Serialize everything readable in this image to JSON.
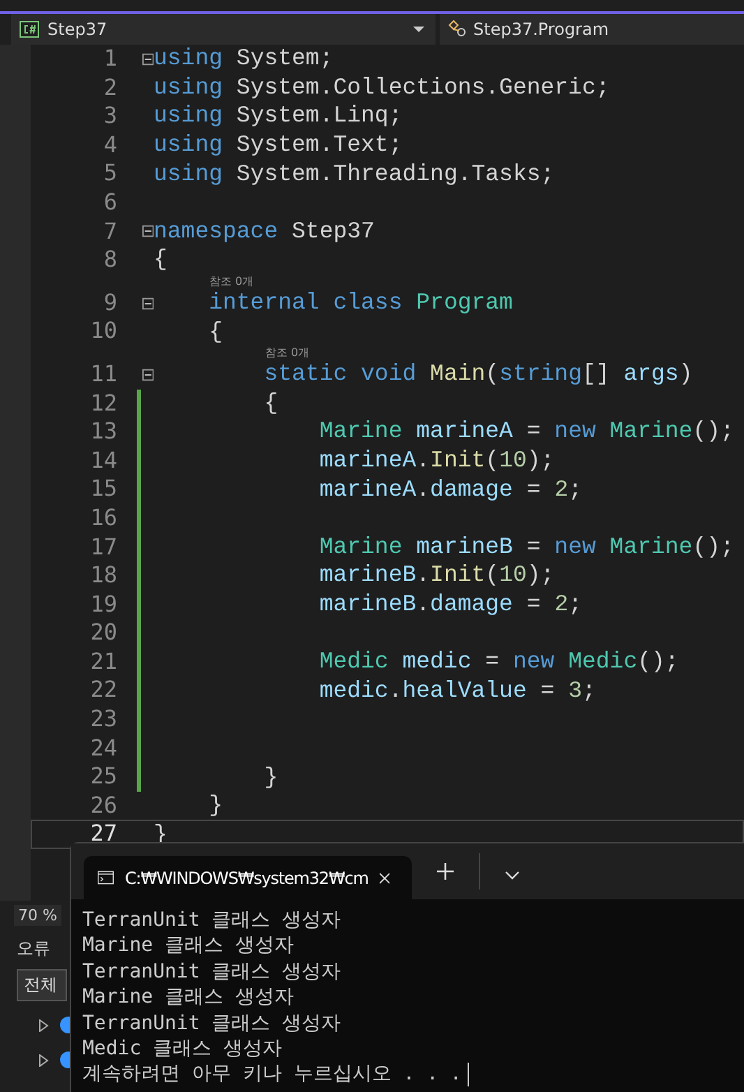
{
  "nav_bar": {
    "project": "Step37",
    "member": "Step37.Program"
  },
  "editor": {
    "lines": [
      {
        "number": "1",
        "changed": false,
        "current": false,
        "fold": true,
        "tokens": [
          {
            "text": "using",
            "kind": "keyword"
          },
          {
            "text": " System;",
            "kind": "plain"
          }
        ]
      },
      {
        "number": "2",
        "changed": false,
        "current": false,
        "fold": false,
        "tokens": [
          {
            "text": "using",
            "kind": "keyword"
          },
          {
            "text": " System.Collections.Generic;",
            "kind": "plain"
          }
        ]
      },
      {
        "number": "3",
        "changed": false,
        "current": false,
        "fold": false,
        "tokens": [
          {
            "text": "using",
            "kind": "keyword"
          },
          {
            "text": " System.Linq;",
            "kind": "plain"
          }
        ]
      },
      {
        "number": "4",
        "changed": false,
        "current": false,
        "fold": false,
        "tokens": [
          {
            "text": "using",
            "kind": "keyword"
          },
          {
            "text": " System.Text;",
            "kind": "plain"
          }
        ]
      },
      {
        "number": "5",
        "changed": false,
        "current": false,
        "fold": false,
        "tokens": [
          {
            "text": "using",
            "kind": "keyword"
          },
          {
            "text": " System.Threading.Tasks;",
            "kind": "plain"
          }
        ]
      },
      {
        "number": "6",
        "changed": false,
        "current": false,
        "fold": false
      },
      {
        "number": "7",
        "changed": false,
        "current": false,
        "fold": true,
        "tokens": [
          {
            "text": "namespace",
            "kind": "keyword"
          },
          {
            "text": " Step37",
            "kind": "plain"
          }
        ]
      },
      {
        "number": "8",
        "changed": false,
        "current": false,
        "fold": false,
        "tokens": [
          {
            "text": "{",
            "kind": "plain"
          }
        ]
      },
      {
        "number": "9",
        "changed": false,
        "current": false,
        "fold": true,
        "codelens": "참조 0개",
        "tokens": [
          {
            "text": "    internal class",
            "kind": "keyword"
          },
          {
            "text": " Program",
            "kind": "type"
          }
        ]
      },
      {
        "number": "10",
        "changed": false,
        "current": false,
        "fold": false,
        "tokens": [
          {
            "text": "    {",
            "kind": "plain"
          }
        ]
      },
      {
        "number": "11",
        "changed": false,
        "current": false,
        "fold": true,
        "codelens": "참조 0개",
        "tokens": [
          {
            "text": "        static void",
            "kind": "keyword"
          },
          {
            "text": " Main",
            "kind": "method"
          },
          {
            "text": "(",
            "kind": "plain"
          },
          {
            "text": "string",
            "kind": "keyword"
          },
          {
            "text": "[] ",
            "kind": "plain"
          },
          {
            "text": "args",
            "kind": "variable"
          },
          {
            "text": ")",
            "kind": "plain"
          }
        ]
      },
      {
        "number": "12",
        "changed": true,
        "current": false,
        "fold": false,
        "tokens": [
          {
            "text": "        {",
            "kind": "plain"
          }
        ]
      },
      {
        "number": "13",
        "changed": true,
        "current": false,
        "fold": false,
        "tokens": [
          {
            "text": "            Marine",
            "kind": "type"
          },
          {
            "text": " marineA",
            "kind": "variable"
          },
          {
            "text": " = ",
            "kind": "plain"
          },
          {
            "text": "new",
            "kind": "keyword"
          },
          {
            "text": " Marine",
            "kind": "type"
          },
          {
            "text": "();",
            "kind": "plain"
          }
        ]
      },
      {
        "number": "14",
        "changed": true,
        "current": false,
        "fold": false,
        "tokens": [
          {
            "text": "            marineA",
            "kind": "variable"
          },
          {
            "text": ".",
            "kind": "plain"
          },
          {
            "text": "Init",
            "kind": "method"
          },
          {
            "text": "(",
            "kind": "plain"
          },
          {
            "text": "10",
            "kind": "number"
          },
          {
            "text": ");",
            "kind": "plain"
          }
        ]
      },
      {
        "number": "15",
        "changed": true,
        "current": false,
        "fold": false,
        "tokens": [
          {
            "text": "            marineA",
            "kind": "variable"
          },
          {
            "text": ".",
            "kind": "plain"
          },
          {
            "text": "damage",
            "kind": "variable"
          },
          {
            "text": " = ",
            "kind": "plain"
          },
          {
            "text": "2",
            "kind": "number"
          },
          {
            "text": ";",
            "kind": "plain"
          }
        ]
      },
      {
        "number": "16",
        "changed": true,
        "current": false,
        "fold": false
      },
      {
        "number": "17",
        "changed": true,
        "current": false,
        "fold": false,
        "tokens": [
          {
            "text": "            Marine",
            "kind": "type"
          },
          {
            "text": " marineB",
            "kind": "variable"
          },
          {
            "text": " = ",
            "kind": "plain"
          },
          {
            "text": "new",
            "kind": "keyword"
          },
          {
            "text": " Marine",
            "kind": "type"
          },
          {
            "text": "();",
            "kind": "plain"
          }
        ]
      },
      {
        "number": "18",
        "changed": true,
        "current": false,
        "fold": false,
        "tokens": [
          {
            "text": "            marineB",
            "kind": "variable"
          },
          {
            "text": ".",
            "kind": "plain"
          },
          {
            "text": "Init",
            "kind": "method"
          },
          {
            "text": "(",
            "kind": "plain"
          },
          {
            "text": "10",
            "kind": "number"
          },
          {
            "text": ");",
            "kind": "plain"
          }
        ]
      },
      {
        "number": "19",
        "changed": true,
        "current": false,
        "fold": false,
        "tokens": [
          {
            "text": "            marineB",
            "kind": "variable"
          },
          {
            "text": ".",
            "kind": "plain"
          },
          {
            "text": "damage",
            "kind": "variable"
          },
          {
            "text": " = ",
            "kind": "plain"
          },
          {
            "text": "2",
            "kind": "number"
          },
          {
            "text": ";",
            "kind": "plain"
          }
        ]
      },
      {
        "number": "20",
        "changed": true,
        "current": false,
        "fold": false
      },
      {
        "number": "21",
        "changed": true,
        "current": false,
        "fold": false,
        "tokens": [
          {
            "text": "            Medic",
            "kind": "type"
          },
          {
            "text": " medic",
            "kind": "variable"
          },
          {
            "text": " = ",
            "kind": "plain"
          },
          {
            "text": "new",
            "kind": "keyword"
          },
          {
            "text": " Medic",
            "kind": "type"
          },
          {
            "text": "();",
            "kind": "plain"
          }
        ]
      },
      {
        "number": "22",
        "changed": true,
        "current": false,
        "fold": false,
        "tokens": [
          {
            "text": "            medic",
            "kind": "variable"
          },
          {
            "text": ".",
            "kind": "plain"
          },
          {
            "text": "healValue",
            "kind": "variable"
          },
          {
            "text": " = ",
            "kind": "plain"
          },
          {
            "text": "3",
            "kind": "number"
          },
          {
            "text": ";",
            "kind": "plain"
          }
        ]
      },
      {
        "number": "23",
        "changed": true,
        "current": false,
        "fold": false
      },
      {
        "number": "24",
        "changed": true,
        "current": false,
        "fold": false
      },
      {
        "number": "25",
        "changed": true,
        "current": false,
        "fold": false,
        "tokens": [
          {
            "text": "        }",
            "kind": "plain"
          }
        ]
      },
      {
        "number": "26",
        "changed": false,
        "current": false,
        "fold": false,
        "tokens": [
          {
            "text": "    }",
            "kind": "plain"
          }
        ]
      },
      {
        "number": "27",
        "changed": false,
        "current": true,
        "fold": false,
        "tokens": [
          {
            "text": "}",
            "kind": "plain"
          }
        ]
      }
    ]
  },
  "status": {
    "zoom": "70 %"
  },
  "error_list": {
    "title": "오류",
    "filter": "전체"
  },
  "terminal": {
    "tab_title": "C:₩WINDOWS₩system32₩cm",
    "output": [
      "TerranUnit 클래스 생성자",
      "Marine 클래스 생성자",
      "TerranUnit 클래스 생성자",
      "Marine 클래스 생성자",
      "TerranUnit 클래스 생성자",
      "Medic 클래스 생성자",
      "계속하려면 아무 키나 누르십시오 . . ."
    ]
  }
}
